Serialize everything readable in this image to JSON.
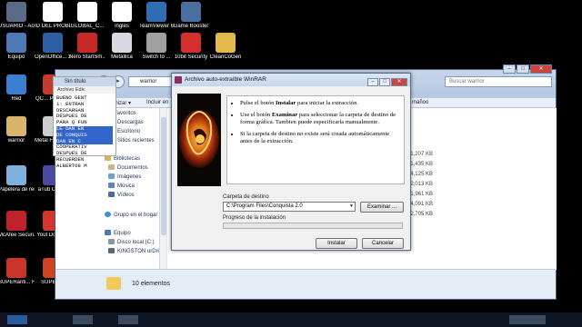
{
  "desktop_icons": [
    {
      "label": "USUARIO - Acceso d...",
      "color": "#5a6b88"
    },
    {
      "label": "ID DEL PROBLEMA",
      "color": "#ffffff"
    },
    {
      "label": "GLOBAL_C...",
      "color": "#ffffff"
    },
    {
      "label": "ingles",
      "color": "#ffffff"
    },
    {
      "label": "TeamViewer 6",
      "color": "#2f6db5"
    },
    {
      "label": "Game Booster",
      "color": "#4a6fa0"
    },
    {
      "label": "Equipo",
      "color": "#4d7ab6"
    },
    {
      "label": "OpenOffice... 3.2",
      "color": "#2e5fa3"
    },
    {
      "label": "Nero StartSm...",
      "color": "#c62828"
    },
    {
      "label": "Metallica",
      "color": "#d8d8e0"
    },
    {
      "label": "Switch to ...",
      "color": "#a0a0a0"
    },
    {
      "label": "10bit Security",
      "color": "#d32f2f"
    },
    {
      "label": "CleanCoGen",
      "color": "#e2b94a"
    },
    {
      "label": "Red",
      "color": "#3a7fd0"
    },
    {
      "label": "QC... Profes...",
      "color": "#c33b2a"
    },
    {
      "label": "warrior",
      "color": "#d9b56a"
    },
    {
      "label": "Metal Fade to...",
      "color": "#cccccc"
    },
    {
      "label": "Papelera de reciclaje",
      "color": "#7fb0e0"
    },
    {
      "label": "aTub Catc...",
      "color": "#4a4aa0"
    },
    {
      "label": "McAfee Securi...",
      "color": "#c0222a"
    },
    {
      "label": "Yout Downl...",
      "color": "#d4352d"
    },
    {
      "label": "SUPERanti... Free Edition",
      "color": "#c9352a"
    },
    {
      "label": "SUPER...",
      "color": "#cc4422"
    }
  ],
  "notepad": {
    "title": "Sin título",
    "menu": "Archivo  Edic",
    "lines": [
      "BUENO GENT",
      "1: ENTRAN",
      "DESCARGAN",
      "DESPUES DE",
      "PARA Q FUN",
      "LE DAN EN",
      "DE CONQUIS",
      "DAN EN C",
      "COOPERATIV",
      "DESPUES DE",
      "RECUERDEN",
      "ALBERTO8 M"
    ],
    "selected_lines": [
      5,
      6,
      7
    ]
  },
  "explorer": {
    "address": "warrior",
    "search_placeholder": "Buscar warrior",
    "toolbar": {
      "organize": "Organizar ▾",
      "include": "Incluir en"
    },
    "sidebar": {
      "favorites": "Favoritos",
      "downloads": "Descargas",
      "desktop": "Escritorio",
      "recent": "Sitios recientes",
      "libraries": "Bibliotecas",
      "documents": "Documentos",
      "images": "Imágenes",
      "music": "Música",
      "videos": "Vídeos",
      "homegroup": "Grupo en el hogar",
      "computer": "Equipo",
      "local_disk": "Disco local (C:)",
      "kingston": "KINGSTON urDriv..."
    },
    "column_header": "mañoo",
    "sizes": [
      "81,207 KB",
      "81,435 KB",
      "84,125 KB",
      "2,013 KB",
      "1,961 KB",
      "4,091 KB",
      "2,705 KB"
    ],
    "status": "10 elementos"
  },
  "winrar": {
    "title": "Archivo auto-extraíble WinRAR",
    "bullets": [
      {
        "pre": "Pulse el botón ",
        "bold": "Instalar",
        "post": " para iniciar la extracción."
      },
      {
        "pre": "Use el botón ",
        "bold": "Examinar",
        "post": " para seleccionar la carpeta de destino de forma gráfica. Tambien puede especificarla manualmente."
      },
      {
        "pre": "Si la carpeta de destino no existe será creada automáticamente antes de la extracción.",
        "bold": "",
        "post": ""
      }
    ],
    "dest_label": "Carpeta de destino",
    "dest_value": "C:\\Program Files\\Conquista 2.0",
    "browse_label": "Examinar ...",
    "progress_label": "Progreso de la instalación",
    "progress": 0,
    "install_label": "Instalar",
    "cancel_label": "Cancelar"
  }
}
